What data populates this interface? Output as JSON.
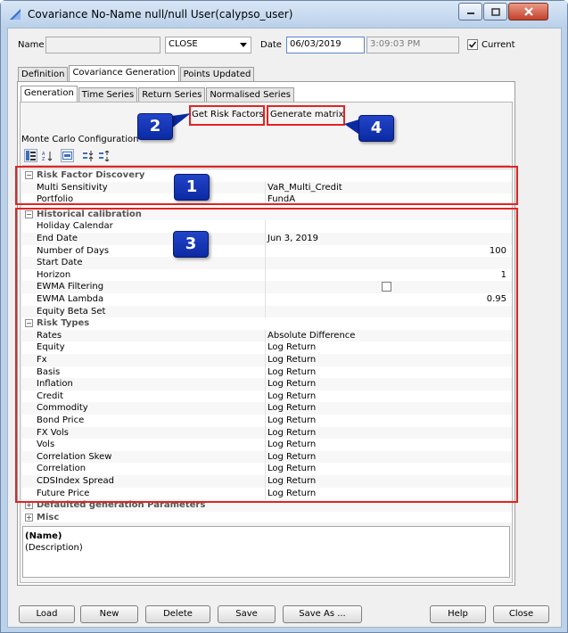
{
  "window": {
    "title": "Covariance  No-Name null/null  User(calypso_user)"
  },
  "header": {
    "name_label": "Name",
    "name_value": "",
    "type_value": "CLOSE",
    "date_label": "Date",
    "date_value": "06/03/2019",
    "time_value": "3:09:03 PM",
    "current_label": "Current",
    "current_checked": true
  },
  "tabs": [
    {
      "label": "Definition"
    },
    {
      "label": "Covariance Generation"
    },
    {
      "label": "Points Updated"
    }
  ],
  "subtabs": [
    {
      "label": "Generation"
    },
    {
      "label": "Time Series"
    },
    {
      "label": "Return Series"
    },
    {
      "label": "Normalised Series"
    }
  ],
  "actions": {
    "get_risk_factors": "Get Risk Factors",
    "generate_matrix": "Generate matrix"
  },
  "section_title": "Monte Carlo Configuration",
  "properties": {
    "risk_factor_discovery": {
      "title": "Risk Factor Discovery",
      "rows": [
        {
          "key": "Multi Sensitivity",
          "value": "VaR_Multi_Credit"
        },
        {
          "key": "Portfolio",
          "value": "FundA"
        }
      ]
    },
    "historical_calibration": {
      "title": "Historical calibration",
      "rows": [
        {
          "key": "Holiday Calendar",
          "value": ""
        },
        {
          "key": "End Date",
          "value": "Jun 3, 2019"
        },
        {
          "key": "Number of Days",
          "value": "100"
        },
        {
          "key": "Start Date",
          "value": ""
        },
        {
          "key": "Horizon",
          "value": "1"
        },
        {
          "key": "EWMA Filtering",
          "value": ""
        },
        {
          "key": "EWMA Lambda",
          "value": "0.95"
        },
        {
          "key": "Equity Beta Set",
          "value": ""
        }
      ]
    },
    "risk_types": {
      "title": "Risk Types",
      "rows": [
        {
          "key": "Rates",
          "value": "Absolute Difference"
        },
        {
          "key": "Equity",
          "value": "Log Return"
        },
        {
          "key": "Fx",
          "value": "Log Return"
        },
        {
          "key": "Basis",
          "value": "Log Return"
        },
        {
          "key": "Inflation",
          "value": "Log Return"
        },
        {
          "key": "Credit",
          "value": "Log Return"
        },
        {
          "key": "Commodity",
          "value": "Log Return"
        },
        {
          "key": "Bond Price",
          "value": "Log Return"
        },
        {
          "key": "FX Vols",
          "value": "Log Return"
        },
        {
          "key": "Vols",
          "value": "Log Return"
        },
        {
          "key": "Correlation Skew",
          "value": "Log Return"
        },
        {
          "key": "Correlation",
          "value": "Log Return"
        },
        {
          "key": "CDSIndex Spread",
          "value": "Log Return"
        },
        {
          "key": "Future Price",
          "value": "Log Return"
        }
      ]
    },
    "defaulted": {
      "title": "Defaulted generation Parameters"
    },
    "misc": {
      "title": "Misc"
    }
  },
  "description": {
    "name": "(Name)",
    "text": "(Description)"
  },
  "callouts": [
    "1",
    "2",
    "3",
    "4"
  ],
  "buttons": {
    "load": "Load",
    "new": "New",
    "delete": "Delete",
    "save": "Save",
    "save_as": "Save As ...",
    "help": "Help",
    "close": "Close"
  },
  "colors": {
    "accent": "#0b2aa3",
    "highlight": "#e02424",
    "titlebar": "#bcd2ea"
  }
}
